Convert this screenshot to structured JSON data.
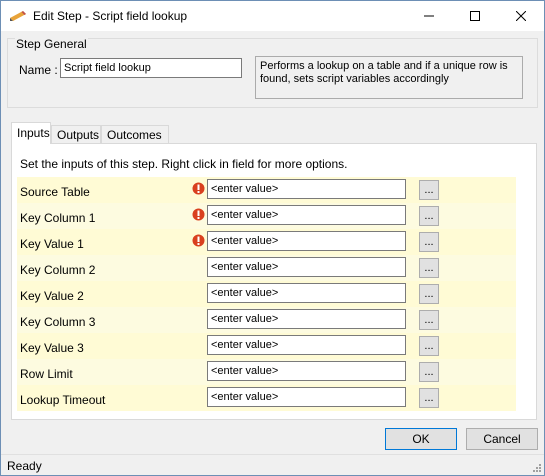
{
  "window": {
    "title": "Edit Step - Script field lookup",
    "icons": {
      "app": "pencil-icon",
      "minimize": "minimize-icon",
      "maximize": "maximize-icon",
      "close": "close-icon"
    }
  },
  "general": {
    "legend": "Step General",
    "name_label": "Name :",
    "name_value": "Script field lookup",
    "description": "Performs a lookup on a table and if a unique row is found, sets script variables accordingly"
  },
  "tabs": [
    {
      "label": "Inputs",
      "active": true
    },
    {
      "label": "Outputs",
      "active": false
    },
    {
      "label": "Outcomes",
      "active": false
    }
  ],
  "inputs": {
    "instructions": "Set the inputs of this step.  Right click in field for more options.",
    "rows": [
      {
        "label": "Source Table",
        "value": "<enter value>",
        "required": true,
        "button": "..."
      },
      {
        "label": "Key Column 1",
        "value": "<enter value>",
        "required": true,
        "button": "..."
      },
      {
        "label": "Key Value 1",
        "value": "<enter value>",
        "required": true,
        "button": "..."
      },
      {
        "label": "Key Column 2",
        "value": "<enter value>",
        "required": false,
        "button": "..."
      },
      {
        "label": "Key Value 2",
        "value": "<enter value>",
        "required": false,
        "button": "..."
      },
      {
        "label": "Key Column 3",
        "value": "<enter value>",
        "required": false,
        "button": "..."
      },
      {
        "label": "Key Value 3",
        "value": "<enter value>",
        "required": false,
        "button": "..."
      },
      {
        "label": "Row Limit",
        "value": "<enter value>",
        "required": false,
        "button": "..."
      },
      {
        "label": "Lookup Timeout",
        "value": "<enter value>",
        "required": false,
        "button": "..."
      }
    ],
    "warning_icon": "error-icon",
    "warning_color": "#d9401f",
    "row_colors": [
      "#fffbd5",
      "#fdfbe0"
    ]
  },
  "buttons": {
    "ok": "OK",
    "cancel": "Cancel"
  },
  "status": {
    "text": "Ready"
  }
}
